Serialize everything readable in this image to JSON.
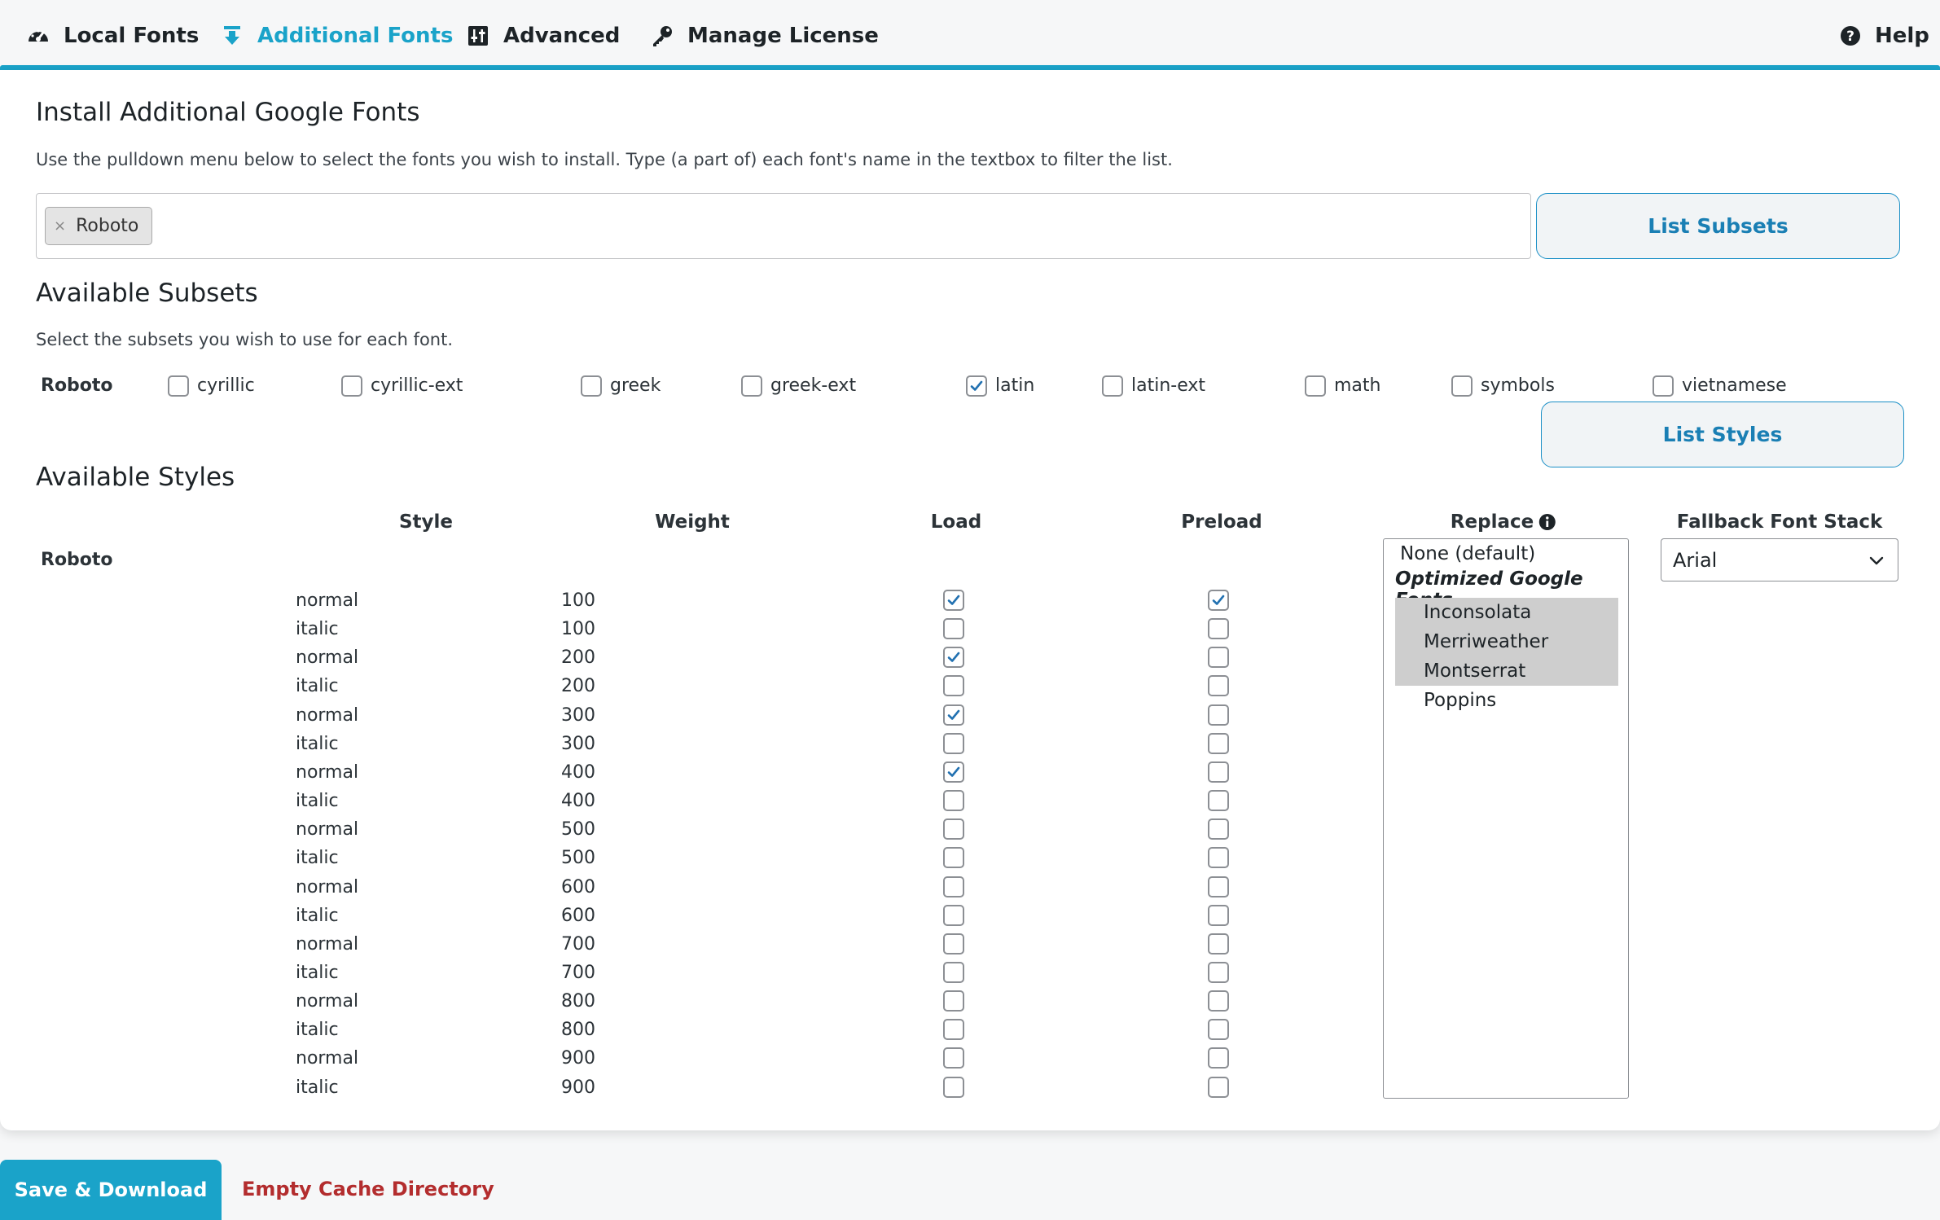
{
  "nav": {
    "items": [
      {
        "label": "Local Fonts",
        "icon": "gauge-icon"
      },
      {
        "label": "Additional Fonts",
        "icon": "download-icon",
        "active": true
      },
      {
        "label": "Advanced",
        "icon": "sliders-icon"
      },
      {
        "label": "Manage License",
        "icon": "key-icon"
      }
    ],
    "help": {
      "label": "Help",
      "icon": "question-circle-icon"
    },
    "accent_color": "#1aa3c9"
  },
  "install": {
    "title": "Install Additional Google Fonts",
    "description": "Use the pulldown menu below to select the fonts you wish to install. Type (a part of) each font's name in the textbox to filter the list.",
    "selected_tag": "Roboto",
    "tag_remove": "×",
    "list_subsets_label": "List Subsets"
  },
  "subsets": {
    "title": "Available Subsets",
    "description": "Select the subsets you wish to use for each font.",
    "font": "Roboto",
    "items": [
      {
        "label": "cyrillic",
        "checked": false
      },
      {
        "label": "cyrillic-ext",
        "checked": false
      },
      {
        "label": "greek",
        "checked": false
      },
      {
        "label": "greek-ext",
        "checked": false
      },
      {
        "label": "latin",
        "checked": true
      },
      {
        "label": "latin-ext",
        "checked": false
      },
      {
        "label": "math",
        "checked": false
      },
      {
        "label": "symbols",
        "checked": false
      },
      {
        "label": "vietnamese",
        "checked": false
      }
    ],
    "list_styles_label": "List Styles"
  },
  "styles": {
    "title": "Available Styles",
    "font": "Roboto",
    "columns": {
      "style": "Style",
      "weight": "Weight",
      "load": "Load",
      "preload": "Preload",
      "replace": "Replace",
      "fallback": "Fallback Font Stack"
    },
    "rows": [
      {
        "style": "normal",
        "weight": "100",
        "load": true,
        "preload": true
      },
      {
        "style": "italic",
        "weight": "100",
        "load": false,
        "preload": false
      },
      {
        "style": "normal",
        "weight": "200",
        "load": true,
        "preload": false
      },
      {
        "style": "italic",
        "weight": "200",
        "load": false,
        "preload": false
      },
      {
        "style": "normal",
        "weight": "300",
        "load": true,
        "preload": false
      },
      {
        "style": "italic",
        "weight": "300",
        "load": false,
        "preload": false
      },
      {
        "style": "normal",
        "weight": "400",
        "load": true,
        "preload": false
      },
      {
        "style": "italic",
        "weight": "400",
        "load": false,
        "preload": false
      },
      {
        "style": "normal",
        "weight": "500",
        "load": false,
        "preload": false
      },
      {
        "style": "italic",
        "weight": "500",
        "load": false,
        "preload": false
      },
      {
        "style": "normal",
        "weight": "600",
        "load": false,
        "preload": false
      },
      {
        "style": "italic",
        "weight": "600",
        "load": false,
        "preload": false
      },
      {
        "style": "normal",
        "weight": "700",
        "load": false,
        "preload": false
      },
      {
        "style": "italic",
        "weight": "700",
        "load": false,
        "preload": false
      },
      {
        "style": "normal",
        "weight": "800",
        "load": false,
        "preload": false
      },
      {
        "style": "italic",
        "weight": "800",
        "load": false,
        "preload": false
      },
      {
        "style": "normal",
        "weight": "900",
        "load": false,
        "preload": false
      },
      {
        "style": "italic",
        "weight": "900",
        "load": false,
        "preload": false
      }
    ],
    "replace": {
      "default_option": "None (default)",
      "group_label": "Optimized Google Fonts",
      "options": [
        {
          "label": "Inconsolata",
          "selected": true
        },
        {
          "label": "Merriweather",
          "selected": true
        },
        {
          "label": "Montserrat",
          "selected": true
        },
        {
          "label": "Poppins",
          "selected": false
        }
      ]
    },
    "fallback_value": "Arial"
  },
  "footer": {
    "save_label": "Save & Download",
    "empty_cache_label": "Empty Cache Directory"
  }
}
